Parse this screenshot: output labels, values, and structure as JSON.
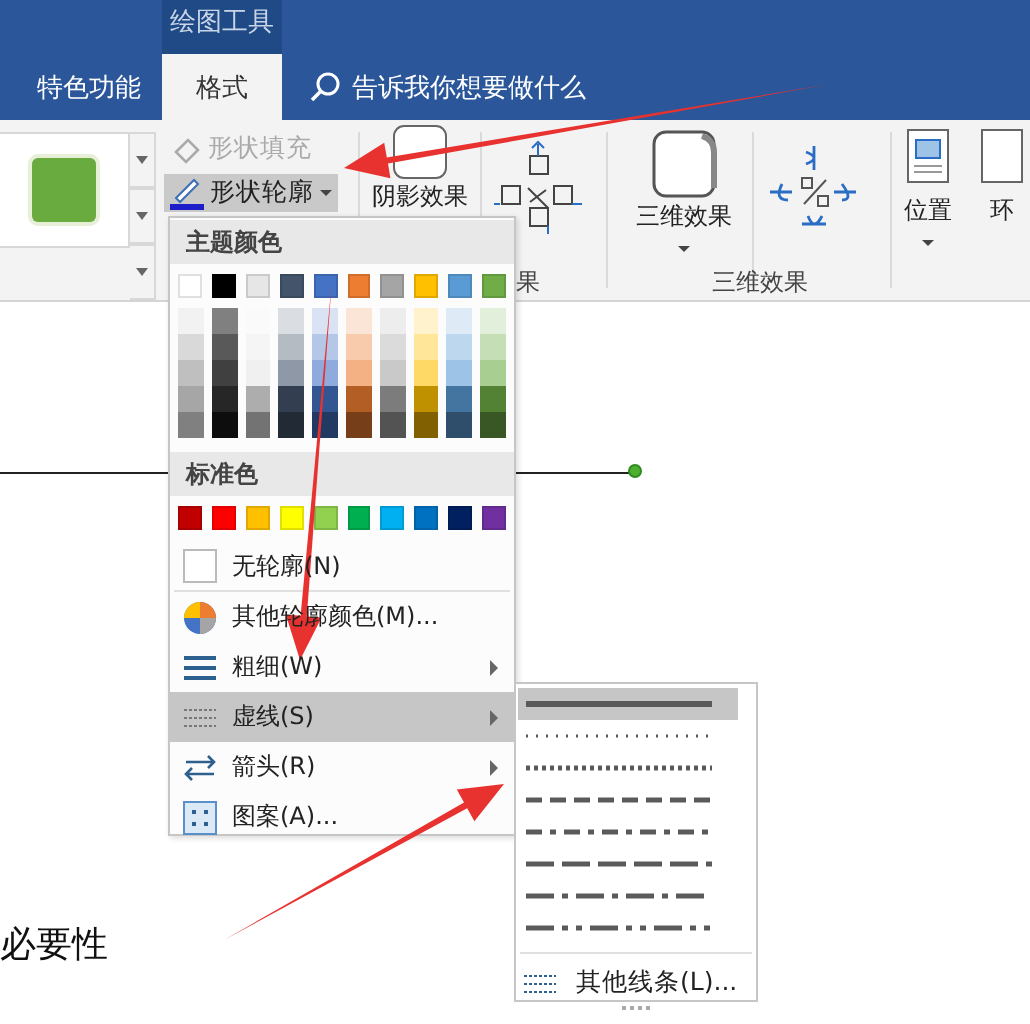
{
  "header": {
    "context_label": "绘图工具",
    "tabs": [
      {
        "label": "特色功能",
        "selected": false
      },
      {
        "label": "格式",
        "selected": true
      }
    ],
    "search": {
      "placeholder": "告诉我你想要做什么"
    }
  },
  "ribbon": {
    "shape_fill": {
      "label": "形状填充",
      "disabled": true
    },
    "shape_outline": {
      "label": "形状轮廓",
      "expanded": true
    },
    "shadow_effects": {
      "label": "阴影效果"
    },
    "group_label_1": "果",
    "three_d": {
      "label": "三维效果"
    },
    "group_label_2": "三维效果",
    "position": {
      "label": "位置"
    },
    "wrap": {
      "label": "环"
    }
  },
  "menu": {
    "theme_header": "主题颜色",
    "theme_colors": [
      {
        "color": "#ffffff"
      },
      {
        "color": "#000000"
      },
      {
        "color": "#e7e6e6"
      },
      {
        "color": "#44546a"
      },
      {
        "color": "#4472c4"
      },
      {
        "color": "#ed7d31"
      },
      {
        "color": "#a5a5a5"
      },
      {
        "color": "#ffc000"
      },
      {
        "color": "#5b9bd5"
      },
      {
        "color": "#70ad47"
      }
    ],
    "standard_header": "标准色",
    "standard_colors": [
      {
        "color": "#c00000"
      },
      {
        "color": "#ff0000"
      },
      {
        "color": "#ffc000"
      },
      {
        "color": "#ffff00"
      },
      {
        "color": "#92d050"
      },
      {
        "color": "#00b050"
      },
      {
        "color": "#00b0f0"
      },
      {
        "color": "#0070c0"
      },
      {
        "color": "#002060"
      },
      {
        "color": "#7030a0"
      }
    ],
    "items": [
      {
        "kind": "no_outline",
        "label": "无轮廓(N)",
        "has_submenu": false,
        "selected": false
      },
      {
        "kind": "more_colors",
        "label": "其他轮廓颜色(M)...",
        "has_submenu": false,
        "selected": false
      },
      {
        "kind": "weight",
        "label": "粗细(W)",
        "has_submenu": true,
        "selected": false
      },
      {
        "kind": "dash",
        "label": "虚线(S)",
        "has_submenu": true,
        "selected": true
      },
      {
        "kind": "arrows",
        "label": "箭头(R)",
        "has_submenu": true,
        "selected": false
      },
      {
        "kind": "pattern",
        "label": "图案(A)...",
        "has_submenu": false,
        "selected": false
      }
    ]
  },
  "submenu": {
    "dashes": [
      {
        "kind": "solid",
        "selected": true
      },
      {
        "kind": "round_dot",
        "selected": false
      },
      {
        "kind": "square_dot",
        "selected": false
      },
      {
        "kind": "dash",
        "selected": false
      },
      {
        "kind": "dash_dot",
        "selected": false
      },
      {
        "kind": "long_dash",
        "selected": false
      },
      {
        "kind": "long_dash_dot",
        "selected": false
      },
      {
        "kind": "long_dash_dot_dot",
        "selected": false
      }
    ],
    "more_lines": "其他线条(L)..."
  },
  "document": {
    "heading": "必要性"
  }
}
